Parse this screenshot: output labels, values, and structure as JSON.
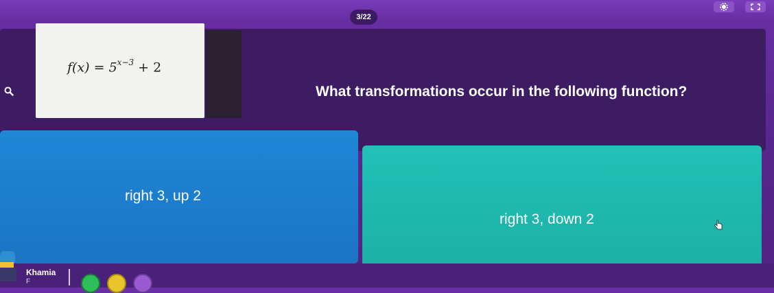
{
  "header": {
    "question_counter": "3/22"
  },
  "question": {
    "formula_base": "f(x) = 5",
    "formula_exponent": "x−3",
    "formula_suffix": " + 2",
    "text": "What transformations occur in the following function?"
  },
  "options": [
    {
      "label": "right 3, up 2",
      "color": "#1f87d6"
    },
    {
      "label": "right 3, down 2",
      "color": "#22c1b6"
    }
  ],
  "player": {
    "name": "Khamia",
    "sub": "F"
  },
  "powerups": [
    {
      "icon": "powerup-green-icon",
      "color": "#2fbf5a"
    },
    {
      "icon": "powerup-yellow-icon",
      "color": "#e8c52a"
    },
    {
      "icon": "powerup-purple-icon",
      "color": "#9a5ad0"
    }
  ],
  "colors": {
    "background": "#5a2890",
    "panel": "#3d1c63"
  }
}
